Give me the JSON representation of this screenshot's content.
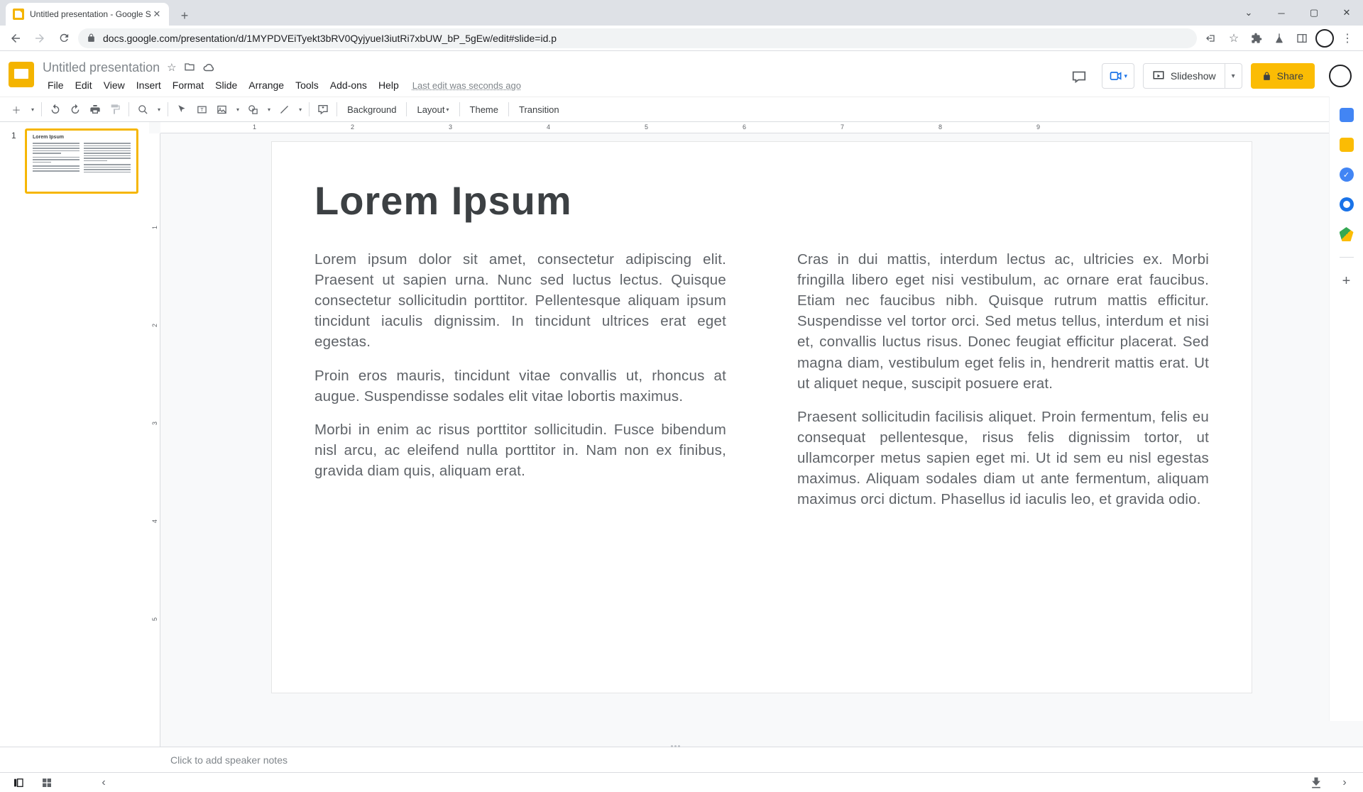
{
  "browser": {
    "tab_title": "Untitled presentation - Google S",
    "url": "docs.google.com/presentation/d/1MYPDVEiTyekt3bRV0QyjyueI3iutRi7xbUW_bP_5gEw/edit#slide=id.p"
  },
  "doc": {
    "title": "Untitled presentation",
    "last_edit": "Last edit was seconds ago"
  },
  "menus": [
    "File",
    "Edit",
    "View",
    "Insert",
    "Format",
    "Slide",
    "Arrange",
    "Tools",
    "Add-ons",
    "Help"
  ],
  "toolbar": {
    "background": "Background",
    "layout": "Layout",
    "theme": "Theme",
    "transition": "Transition"
  },
  "header_buttons": {
    "slideshow": "Slideshow",
    "share": "Share"
  },
  "slide": {
    "number": "1",
    "title": "Lorem Ipsum",
    "left_paragraphs": [
      "Lorem ipsum dolor sit amet, consectetur adipiscing elit. Praesent ut sapien urna. Nunc sed luctus lectus. Quisque consectetur sollicitudin porttitor. Pellentesque aliquam ipsum tincidunt iaculis dignissim. In tincidunt ultrices erat eget egestas.",
      "Proin eros mauris, tincidunt vitae convallis ut, rhoncus at augue. Suspendisse sodales elit vitae lobortis maximus.",
      "Morbi in enim ac risus porttitor sollicitudin. Fusce bibendum nisl arcu, ac eleifend nulla porttitor in. Nam non ex finibus, gravida diam quis, aliquam erat."
    ],
    "right_paragraphs": [
      "Cras in dui mattis, interdum lectus ac, ultricies ex. Morbi fringilla libero eget nisi vestibulum, ac ornare erat faucibus. Etiam nec faucibus nibh. Quisque rutrum mattis efficitur. Suspendisse vel tortor orci. Sed metus tellus, interdum et nisi et, convallis luctus risus. Donec feugiat efficitur placerat. Sed magna diam, vestibulum eget felis in, hendrerit mattis erat. Ut ut aliquet neque, suscipit posuere erat.",
      "Praesent sollicitudin facilisis aliquet. Proin fermentum, felis eu consequat pellentesque, risus felis dignissim tortor, ut ullamcorper metus sapien eget mi. Ut id sem eu nisl egestas maximus. Aliquam sodales diam ut ante fermentum, aliquam maximus orci dictum. Phasellus id iaculis leo, et gravida odio."
    ]
  },
  "notes_placeholder": "Click to add speaker notes",
  "ruler_h": [
    "",
    "1",
    "2",
    "3",
    "4",
    "5",
    "6",
    "7",
    "8",
    "9",
    ""
  ],
  "ruler_v": [
    "",
    "1",
    "2",
    "3",
    "4",
    "5"
  ]
}
